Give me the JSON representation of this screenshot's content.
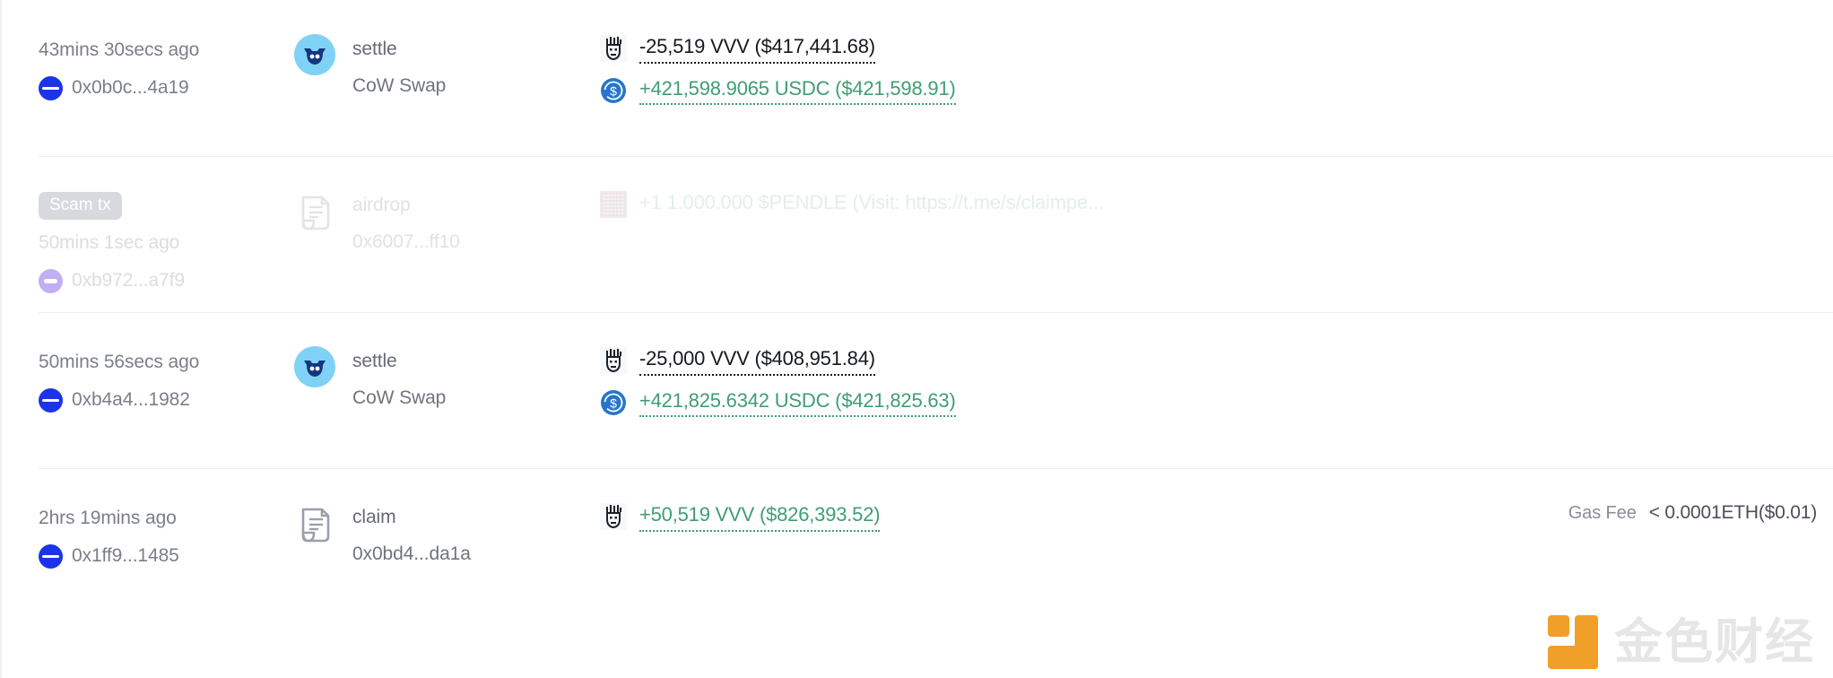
{
  "list": {
    "name": "transaction-list",
    "rows": [
      {
        "badge": null,
        "time": "43mins 30secs ago",
        "hash": "0x0b0c...4a19",
        "chain_icon": "chain-circle-icon",
        "chain_color": "#1b34e8",
        "method": "settle",
        "method_target": "CoW Swap",
        "method_icon": "cow-swap-icon",
        "amounts": [
          {
            "icon": "vvv-token-icon",
            "text": "-25,519 VVV ($417,441.68)",
            "sign": "neg"
          },
          {
            "icon": "usdc-token-icon",
            "text": "+421,598.9065 USDC ($421,598.91)",
            "sign": "pos"
          }
        ],
        "gas_label": null,
        "gas_value": null
      },
      {
        "badge": "Scam tx",
        "time": "50mins 1sec ago",
        "hash": "0xb972...a7f9",
        "chain_icon": "chain-circle-icon",
        "chain_color": "#c2aef2",
        "method": "airdrop",
        "method_target": "0x6007...ff10",
        "method_icon": "contract-document-icon",
        "amounts": [
          {
            "icon": "qr-code-icon",
            "text": "+1 1.000.000 $PENDLE (Visit: https://t.me/s/claimpe...",
            "sign": "scam"
          }
        ],
        "gas_label": null,
        "gas_value": null
      },
      {
        "badge": null,
        "time": "50mins 56secs ago",
        "hash": "0xb4a4...1982",
        "chain_icon": "chain-circle-icon",
        "chain_color": "#1b34e8",
        "method": "settle",
        "method_target": "CoW Swap",
        "method_icon": "cow-swap-icon",
        "amounts": [
          {
            "icon": "vvv-token-icon",
            "text": "-25,000 VVV ($408,951.84)",
            "sign": "neg"
          },
          {
            "icon": "usdc-token-icon",
            "text": "+421,825.6342 USDC ($421,825.63)",
            "sign": "pos"
          }
        ],
        "gas_label": null,
        "gas_value": null
      },
      {
        "badge": null,
        "time": "2hrs 19mins ago",
        "hash": "0x1ff9...1485",
        "chain_icon": "chain-circle-icon",
        "chain_color": "#1b34e8",
        "method": "claim",
        "method_target": "0x0bd4...da1a",
        "method_icon": "contract-document-icon",
        "amounts": [
          {
            "icon": "vvv-token-icon",
            "text": "+50,519 VVV ($826,393.52)",
            "sign": "pos"
          }
        ],
        "gas_label": "Gas Fee",
        "gas_value": "< 0.0001ETH($0.01)"
      }
    ]
  },
  "watermark": {
    "text": "金色财经",
    "mark_color": "#f0a028"
  },
  "colors": {
    "positive": "#3f9e72",
    "negative": "#15181f",
    "muted": "#7b7f8a",
    "divider": "#f0f0f2",
    "scam_badge_bg": "#d7d9de",
    "chain_blue": "#1b34e8",
    "chain_purple": "#c2aef2",
    "cow_bg": "#7fd2f5",
    "cow_fg": "#14357f",
    "usdc": "#2775ca"
  }
}
